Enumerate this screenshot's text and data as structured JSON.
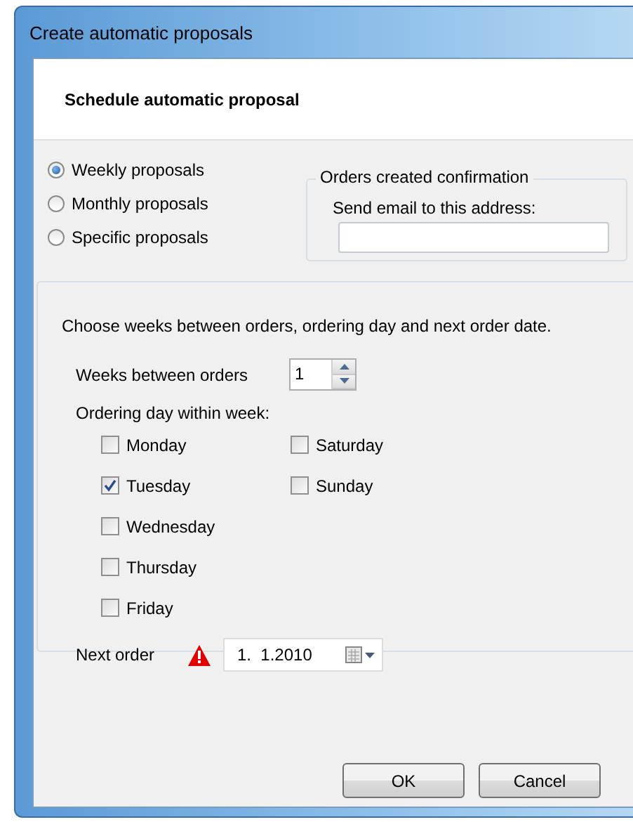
{
  "window": {
    "title": "Create automatic proposals"
  },
  "header": "Schedule automatic proposal",
  "proposal_types": [
    {
      "label": "Weekly proposals",
      "selected": true
    },
    {
      "label": "Monthly proposals",
      "selected": false
    },
    {
      "label": "Specific proposals",
      "selected": false
    }
  ],
  "confirmation": {
    "legend": "Orders created confirmation",
    "label": "Send email to this address:"
  },
  "instructions": "Choose weeks between orders, ordering day and next order date.",
  "weeks_between": {
    "label": "Weeks between orders",
    "value": "1"
  },
  "ordering_day_label": "Ordering day within week:",
  "days": [
    {
      "label": "Monday",
      "checked": false
    },
    {
      "label": "Tuesday",
      "checked": true
    },
    {
      "label": "Wednesday",
      "checked": false
    },
    {
      "label": "Thursday",
      "checked": false
    },
    {
      "label": "Friday",
      "checked": false
    },
    {
      "label": "Saturday",
      "checked": false
    },
    {
      "label": "Sunday",
      "checked": false
    }
  ],
  "next_order": {
    "label": "Next order",
    "warning": true,
    "value": "1.  1.2010"
  },
  "buttons": [
    "OK",
    "Cancel"
  ]
}
